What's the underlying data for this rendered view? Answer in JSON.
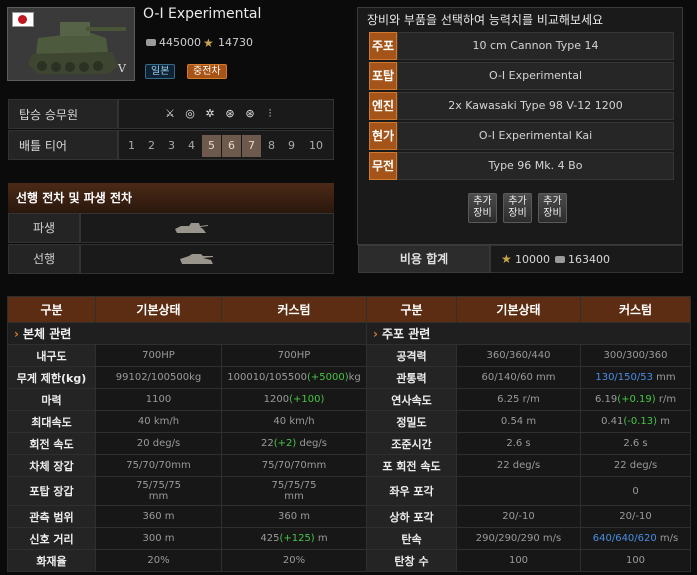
{
  "tank": {
    "name": "O-I Experimental",
    "tier_roman": "V",
    "price_silver": "445000",
    "price_xp": "14730",
    "nation": "일본",
    "class": "중전차"
  },
  "crew": {
    "label": "탑승 승무원",
    "icons": [
      "commander-icon",
      "gunner-icon",
      "driver-icon",
      "radio-operator-icon",
      "radio-operator-icon",
      "loader-icon"
    ]
  },
  "tier": {
    "label": "배틀 티어",
    "values": [
      "1",
      "2",
      "3",
      "4",
      "5",
      "6",
      "7",
      "8",
      "9",
      "10"
    ],
    "active": [
      "5",
      "6",
      "7"
    ]
  },
  "related": {
    "header": "선행 전차 및 파생 전차",
    "derived_label": "파생",
    "prev_label": "선행"
  },
  "compare": {
    "title": "장비와 부품을 선택하여 능력치를 비교해보세요",
    "rows": [
      {
        "label": "주포",
        "value": "10 cm Cannon Type 14"
      },
      {
        "label": "포탑",
        "value": "O-I Experimental"
      },
      {
        "label": "엔진",
        "value": "2x Kawasaki Type 98 V-12 1200"
      },
      {
        "label": "현가",
        "value": "O-I Experimental Kai"
      },
      {
        "label": "무전",
        "value": "Type 96 Mk. 4 Bo"
      }
    ],
    "add_label": [
      "추가\n장비",
      "추가\n장비",
      "추가\n장비"
    ],
    "total_label": "비용 합계",
    "total_xp": "10000",
    "total_silver": "163400"
  },
  "stats": {
    "headers": [
      "구분",
      "기본상태",
      "커스텀",
      "구분",
      "기본상태",
      "커스텀"
    ],
    "left_section": "본체 관련",
    "right_section": "주포 관련",
    "left": [
      {
        "label": "내구도",
        "base": "700HP",
        "custom": "700HP",
        "bonus": ""
      },
      {
        "label": "무게 제한(kg)",
        "base": "99102/100500kg",
        "custom": "100010/105500",
        "bonus": "(+5000)",
        "suffix": "kg"
      },
      {
        "label": "마력",
        "base": "1100",
        "custom": "1200",
        "bonus": "(+100)"
      },
      {
        "label": "최대속도",
        "base": "40 km/h",
        "custom": "40 km/h",
        "bonus": ""
      },
      {
        "label": "회전 속도",
        "base": "20 deg/s",
        "custom": "22",
        "bonus": "(+2)",
        "suffix": " deg/s"
      },
      {
        "label": "차체 장갑",
        "base": "75/70/70mm",
        "custom": "75/70/70mm",
        "bonus": ""
      },
      {
        "label": "포탑 장갑",
        "base": "75/75/75\nmm",
        "custom": "75/75/75\nmm",
        "bonus": ""
      },
      {
        "label": "관측 범위",
        "base": "360 m",
        "custom": "360 m",
        "bonus": ""
      },
      {
        "label": "신호 거리",
        "base": "300 m",
        "custom": "425",
        "bonus": "(+125)",
        "suffix": " m"
      },
      {
        "label": "화재율",
        "base": "20%",
        "custom": "20%",
        "bonus": ""
      }
    ],
    "right": [
      {
        "label": "공격력",
        "base": "360/360/440",
        "custom": "300/300/360",
        "blue": true
      },
      {
        "label": "관통력",
        "base": "60/140/60 mm",
        "custom": "130/150/53",
        "blue": true,
        "suffix": " mm"
      },
      {
        "label": "연사속도",
        "base": "6.25 r/m",
        "custom": "6.19",
        "bonus": "(+0.19)",
        "suffix": " r/m"
      },
      {
        "label": "정밀도",
        "base": "0.54 m",
        "custom": "0.41",
        "bonus": "(-0.13)",
        "suffix": " m"
      },
      {
        "label": "조준시간",
        "base": "2.6 s",
        "custom": "2.6 s"
      },
      {
        "label": "포 회전 속도",
        "base": "22 deg/s",
        "custom": "22 deg/s"
      },
      {
        "label": "좌우 포각",
        "base": "",
        "custom": "0"
      },
      {
        "label": "상하 포각",
        "base": "20/-10",
        "custom": "20/-10"
      },
      {
        "label": "탄속",
        "base": "290/290/290 m/s",
        "custom": "640/640/620",
        "blue": true,
        "suffix": " m/s"
      },
      {
        "label": "탄창 수",
        "base": "100",
        "custom": "100"
      }
    ]
  }
}
